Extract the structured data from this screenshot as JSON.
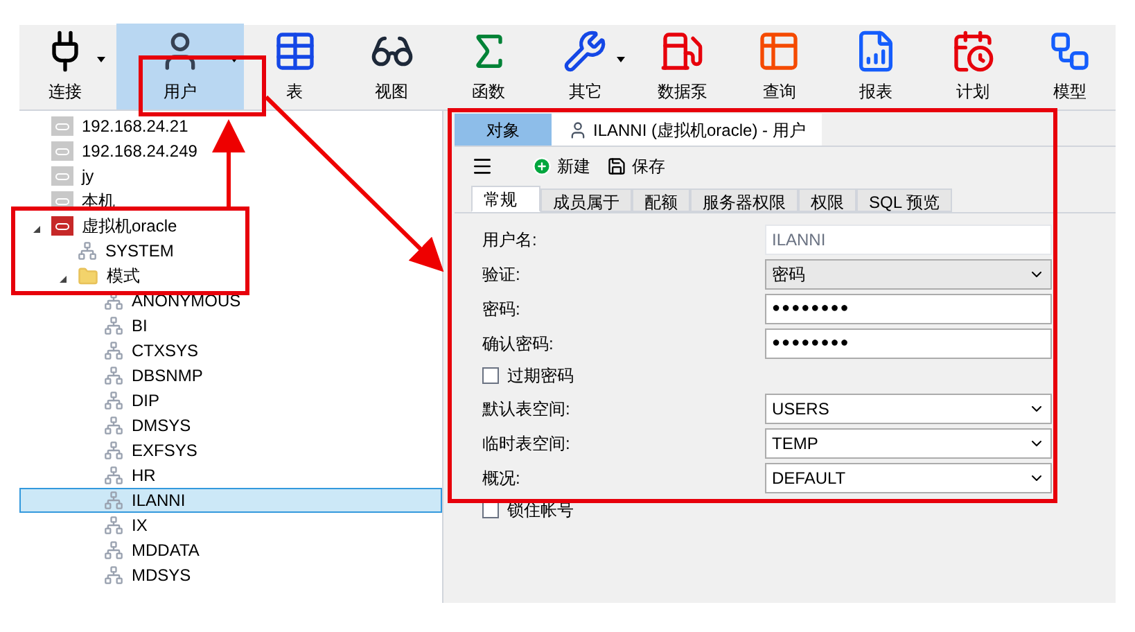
{
  "toolbar": [
    {
      "label": "连接",
      "dropdown": true,
      "selected": false
    },
    {
      "label": "用户",
      "dropdown": true,
      "selected": true
    },
    {
      "label": "表",
      "dropdown": false,
      "selected": false
    },
    {
      "label": "视图",
      "dropdown": false,
      "selected": false
    },
    {
      "label": "函数",
      "dropdown": false,
      "selected": false
    },
    {
      "label": "其它",
      "dropdown": true,
      "selected": false
    },
    {
      "label": "数据泵",
      "dropdown": false,
      "selected": false
    },
    {
      "label": "查询",
      "dropdown": false,
      "selected": false
    },
    {
      "label": "报表",
      "dropdown": false,
      "selected": false
    },
    {
      "label": "计划",
      "dropdown": false,
      "selected": false
    },
    {
      "label": "模型",
      "dropdown": false,
      "selected": false
    }
  ],
  "tree": [
    {
      "label": "192.168.24.21",
      "kind": "connection",
      "open": false,
      "selected": false
    },
    {
      "label": "192.168.24.249",
      "kind": "connection",
      "open": false,
      "selected": false
    },
    {
      "label": "jy",
      "kind": "connection",
      "open": false,
      "selected": false
    },
    {
      "label": "本机",
      "kind": "connection",
      "open": false,
      "selected": false
    },
    {
      "label": "虚拟机oracle",
      "kind": "connection",
      "open": true,
      "expanded": true,
      "selected": false,
      "children": [
        {
          "label": "SYSTEM",
          "kind": "schema",
          "selected": false
        },
        {
          "label": "模式",
          "kind": "folder",
          "expanded": true,
          "selected": false,
          "children": [
            {
              "label": "ANONYMOUS",
              "kind": "schema",
              "selected": false
            },
            {
              "label": "BI",
              "kind": "schema",
              "selected": false
            },
            {
              "label": "CTXSYS",
              "kind": "schema",
              "selected": false
            },
            {
              "label": "DBSNMP",
              "kind": "schema",
              "selected": false
            },
            {
              "label": "DIP",
              "kind": "schema",
              "selected": false
            },
            {
              "label": "DMSYS",
              "kind": "schema",
              "selected": false
            },
            {
              "label": "EXFSYS",
              "kind": "schema",
              "selected": false
            },
            {
              "label": "HR",
              "kind": "schema",
              "selected": false
            },
            {
              "label": "ILANNI",
              "kind": "schema",
              "selected": true
            },
            {
              "label": "IX",
              "kind": "schema",
              "selected": false
            },
            {
              "label": "MDDATA",
              "kind": "schema",
              "selected": false
            },
            {
              "label": "MDSYS",
              "kind": "schema",
              "selected": false
            }
          ]
        }
      ]
    }
  ],
  "editor_tabs": [
    {
      "label": "对象",
      "selected": false,
      "icon": false
    },
    {
      "label": "ILANNI (虚拟机oracle) - 用户",
      "selected": true,
      "icon": true
    }
  ],
  "editor_toolbar": [
    {
      "label": "新建"
    },
    {
      "label": "保存"
    }
  ],
  "subtabs": [
    {
      "label": "常规",
      "selected": true
    },
    {
      "label": "成员属于",
      "selected": false
    },
    {
      "label": "配额",
      "selected": false
    },
    {
      "label": "服务器权限",
      "selected": false
    },
    {
      "label": "权限",
      "selected": false
    },
    {
      "label": "SQL 预览",
      "selected": false
    }
  ],
  "form": [
    {
      "kind": "text",
      "label": "用户名:",
      "value": "ILANNI",
      "disabled": true
    },
    {
      "kind": "select",
      "label": "验证:",
      "value": "密码",
      "disabled": false
    },
    {
      "kind": "password",
      "label": "密码:",
      "value": "●●●●●●●●",
      "disabled": false
    },
    {
      "kind": "password",
      "label": "确认密码:",
      "value": "●●●●●●●●",
      "disabled": false
    },
    {
      "kind": "checkbox",
      "label": "过期密码",
      "checked": false
    },
    {
      "kind": "select",
      "label": "默认表空间:",
      "value": "USERS",
      "disabled": false
    },
    {
      "kind": "select",
      "label": "临时表空间:",
      "value": "TEMP",
      "disabled": false
    },
    {
      "kind": "select",
      "label": "概况:",
      "value": "DEFAULT",
      "disabled": false
    },
    {
      "kind": "checkbox",
      "label": "锁住帐号",
      "checked": false
    }
  ]
}
